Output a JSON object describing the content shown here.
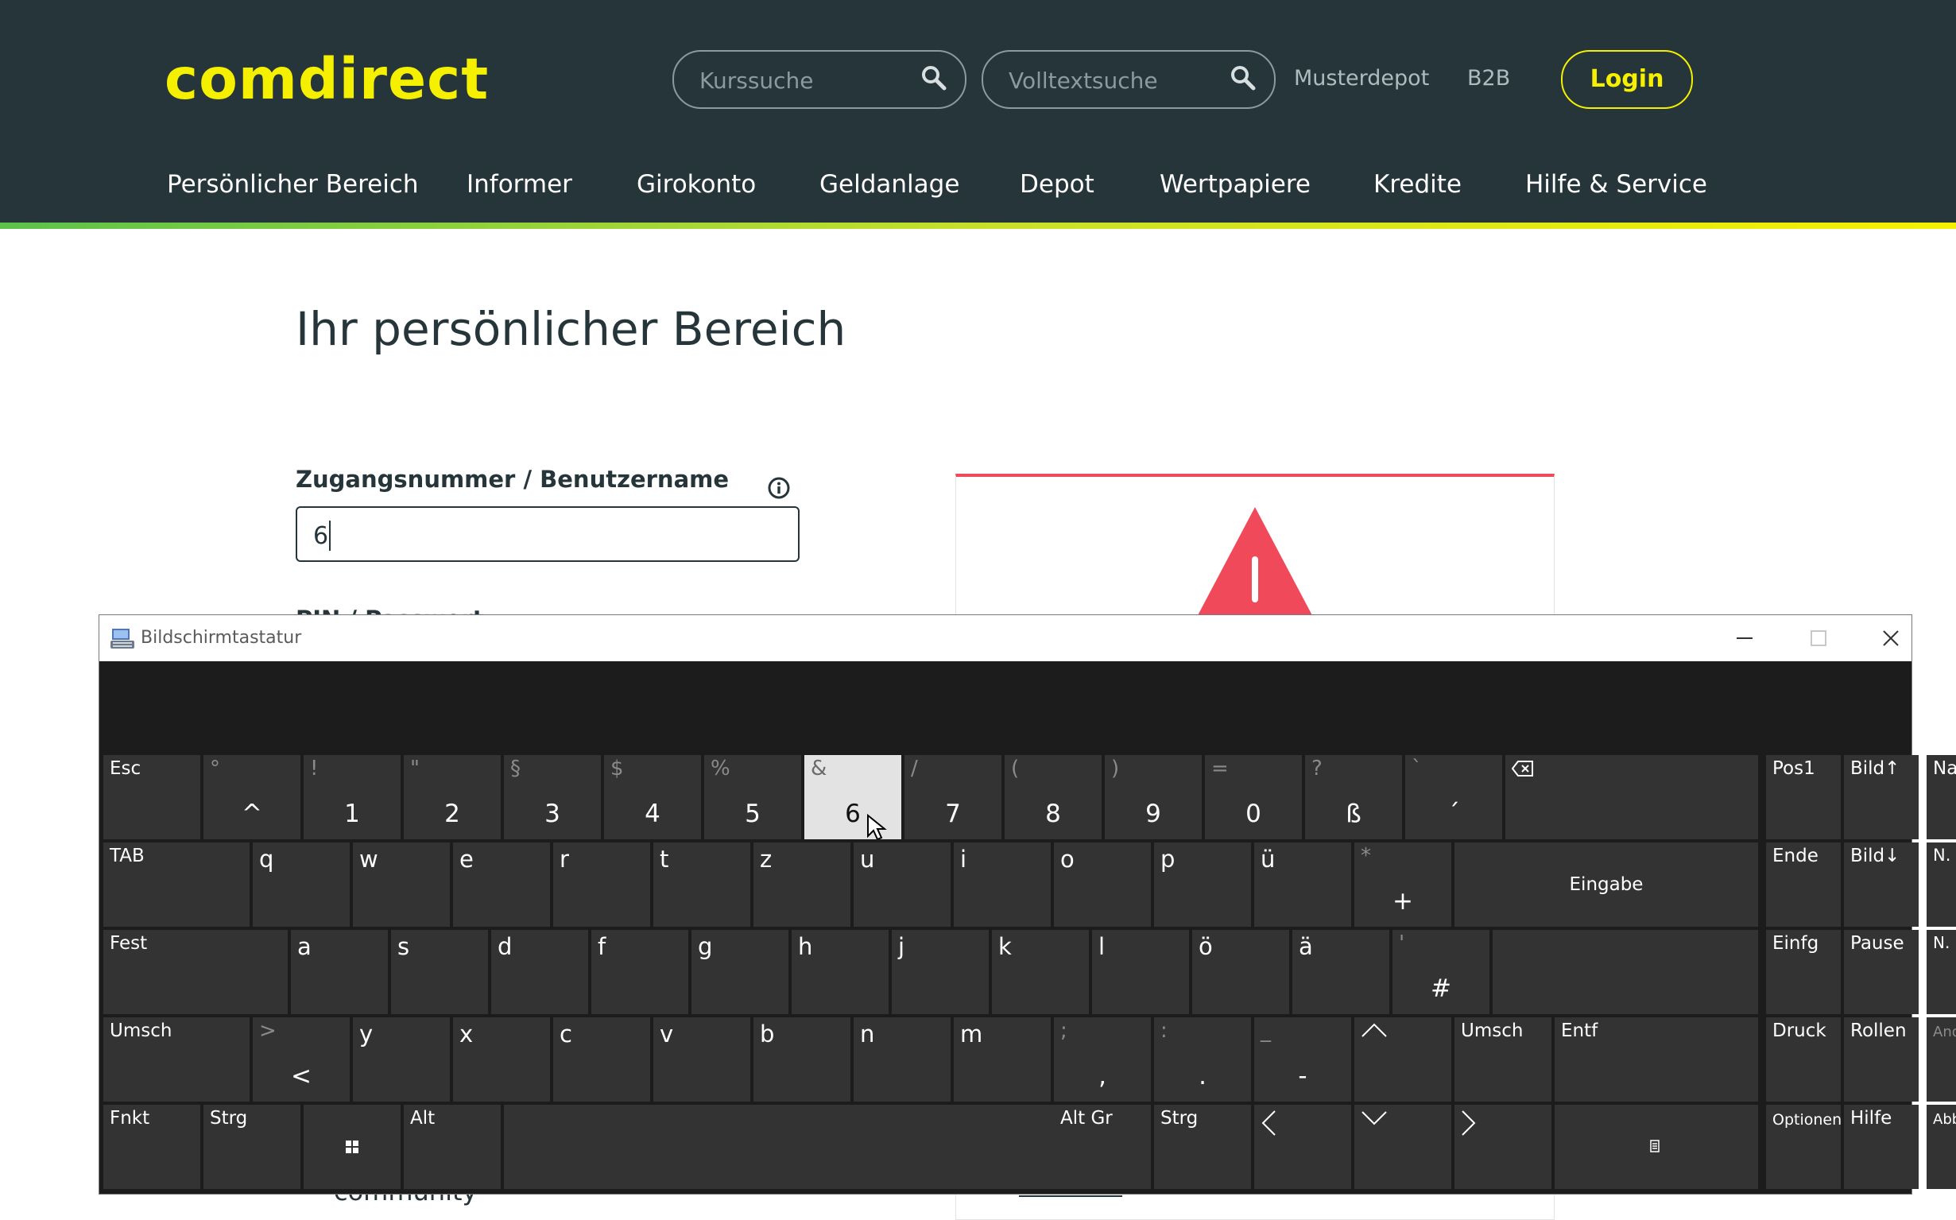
{
  "header": {
    "logo": "comdirect",
    "search_course_placeholder": "Kurssuche",
    "search_fulltext_placeholder": "Volltextsuche",
    "links": [
      "Musterdepot",
      "B2B"
    ],
    "login_label": "Login",
    "nav": [
      "Persönlicher Bereich",
      "Informer",
      "Girokonto",
      "Geldanlage",
      "Depot",
      "Wertpapiere",
      "Kredite",
      "Hilfe & Service"
    ],
    "colors": {
      "bg": "#25353a",
      "brand": "#f5f000"
    }
  },
  "main": {
    "title": "Ihr persönlicher Bereich",
    "user_label": "Zugangsnummer / Benutzername",
    "user_value": "6",
    "pin_label": "PIN / Passwort",
    "partial_text": "community",
    "alert_color": "#f04a5a"
  },
  "osk": {
    "title": "Bildschirmtastatur",
    "pressed_key": "6",
    "keys": {
      "esc": "Esc",
      "caret_shift": "°",
      "caret": "^",
      "n1_shift": "!",
      "n1": "1",
      "n2_shift": "\"",
      "n2": "2",
      "n3_shift": "§",
      "n3": "3",
      "n4_shift": "$",
      "n4": "4",
      "n5_shift": "%",
      "n5": "5",
      "n6_shift": "&",
      "n6": "6",
      "n7_shift": "/",
      "n7": "7",
      "n8_shift": "(",
      "n8": "8",
      "n9_shift": ")",
      "n9": "9",
      "n0_shift": "=",
      "n0": "0",
      "sz_shift": "?",
      "sz": "ß",
      "acute_shift": "`",
      "acute": "´",
      "tab": "TAB",
      "q": "q",
      "w": "w",
      "e": "e",
      "r": "r",
      "t": "t",
      "z": "z",
      "u": "u",
      "i": "i",
      "o": "o",
      "p": "p",
      "ue": "ü",
      "plus_shift": "*",
      "plus": "+",
      "enter": "Eingabe",
      "caps": "Fest",
      "a": "a",
      "s": "s",
      "d": "d",
      "f": "f",
      "g": "g",
      "h": "h",
      "j": "j",
      "k": "k",
      "l": "l",
      "oe": "ö",
      "ae": "ä",
      "hash_shift": "'",
      "hash": "#",
      "shift_l": "Umsch",
      "lt_shift": ">",
      "lt": "<",
      "y": "y",
      "x": "x",
      "c": "c",
      "v": "v",
      "b": "b",
      "n": "n",
      "m": "m",
      "comma_shift": ";",
      "comma": ",",
      "dot_shift": ":",
      "dot": ".",
      "minus_shift": "_",
      "minus": "-",
      "shift_r": "Umsch",
      "del": "Entf",
      "fn": "Fnkt",
      "ctrl_l": "Strg",
      "alt": "Alt",
      "altgr": "Alt Gr",
      "ctrl_r": "Strg",
      "home": "Pos1",
      "pgup": "Bild↑",
      "nav": "Nav",
      "end": "Ende",
      "pgdn": "Bild↓",
      "moveup": "N. oben",
      "ins": "Einfg",
      "pause": "Pause",
      "movedown": "N. unten",
      "prtscn": "Druck",
      "scrlk": "Rollen",
      "dock": "Andocken",
      "options": "Optionen",
      "help": "Hilfe",
      "fade": "Abblenden"
    }
  }
}
